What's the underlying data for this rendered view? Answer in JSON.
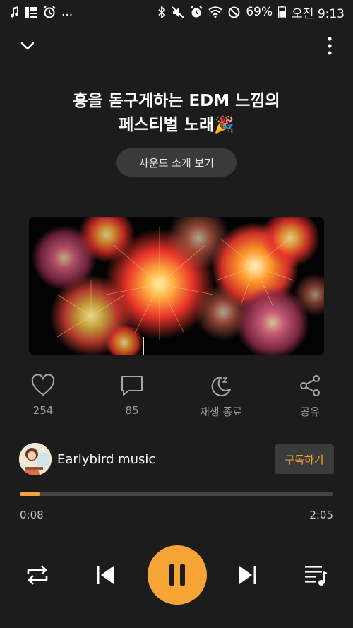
{
  "status_bar": {
    "left_icons": [
      "music-note-icon",
      "news-icon",
      "alarm-clock-icon"
    ],
    "more": "...",
    "right_icons": [
      "bluetooth-icon",
      "mute-icon",
      "alarm-icon",
      "wifi-icon",
      "do-not-disturb-icon"
    ],
    "battery": "69%",
    "time": "오전 9:13"
  },
  "header": {
    "title_line1": "흥을 돋구게하는 EDM 느낌의",
    "title_line2": "페스티벌 노래🎉",
    "intro_button": "사운드 소개 보기"
  },
  "artwork": {
    "subject": "fireworks"
  },
  "actions": {
    "like_count": "254",
    "comment_count": "85",
    "sleep_label": "재생 종료",
    "share_label": "공유"
  },
  "channel": {
    "name": "Earlybird music",
    "subscribe_label": "구독하기"
  },
  "playback": {
    "current_time": "0:08",
    "total_time": "2:05",
    "progress": 0.065
  },
  "colors": {
    "accent": "#f7a437",
    "background": "#1c1c1c"
  }
}
